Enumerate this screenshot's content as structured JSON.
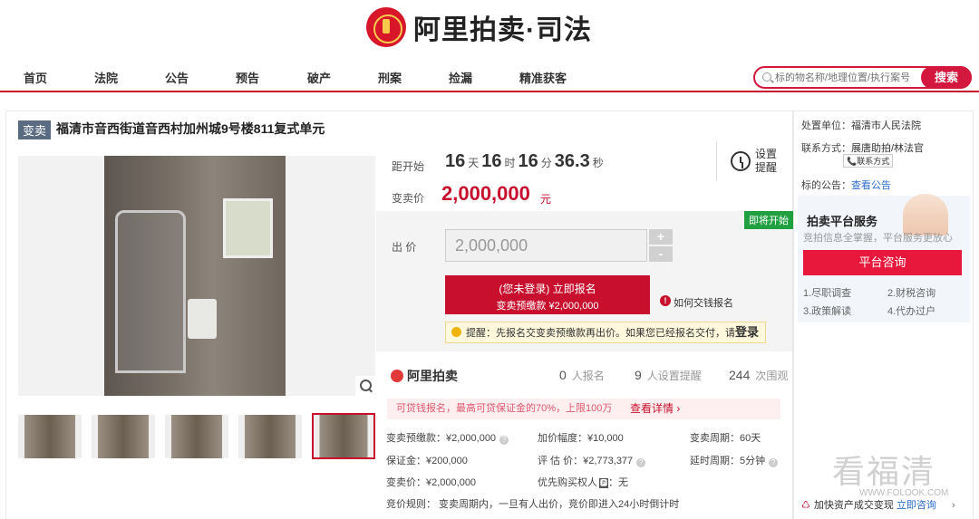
{
  "site": {
    "logo_text": "阿里拍卖·司法"
  },
  "nav": {
    "items": [
      "首页",
      "法院",
      "公告",
      "预告",
      "破产",
      "刑案",
      "捡漏",
      "精准获客"
    ]
  },
  "search": {
    "placeholder": "标的物名称/地理位置/执行案号",
    "button": "搜索"
  },
  "item": {
    "tag": "变卖",
    "title": "福清市音西街道音西村加州城9号楼811复式单元"
  },
  "countdown": {
    "label": "距开始",
    "days": "16",
    "days_unit": "天",
    "hours": "16",
    "hours_unit": "时",
    "minutes": "16",
    "minutes_unit": "分",
    "seconds": "36.3",
    "seconds_unit": "秒"
  },
  "reminder": {
    "label": "设置提醒"
  },
  "price": {
    "label": "变卖价",
    "value": "2,000,000",
    "unit": "元"
  },
  "status_badge": "即将开始",
  "bid": {
    "label": "出 价",
    "value": "2,000,000",
    "plus": "+",
    "minus": "-"
  },
  "signup": {
    "line1": "(您未登录) 立即报名",
    "line2": "变卖预缴款 ¥2,000,000"
  },
  "how_to_pay": {
    "icon": "!",
    "label": "如何交钱报名"
  },
  "tip": {
    "prefix": "提醒：先报名交变卖预缴款再出价。如果您已经报名交付，请",
    "login": "登录"
  },
  "platform": {
    "logo_text": "阿里拍卖"
  },
  "stats": {
    "signups": {
      "value": "0",
      "label": "人报名"
    },
    "reminders": {
      "value": "9",
      "label": "人设置提醒"
    },
    "views": {
      "value": "244",
      "label": "次围观"
    }
  },
  "promo": {
    "text": "可贷钱报名，最高可贷保证金的70%，上限100万",
    "link": "查看详情 ›"
  },
  "details": {
    "deposit_payment": "变卖预缴款：¥2,000,000",
    "increment": "加价幅度：¥10,000",
    "period": "变卖周期：60天",
    "margin": "保证金：¥200,000",
    "appraisal": "评 估 价：¥2,773,377",
    "extension": "延时周期：5分钟",
    "sale_price": "变卖价：¥2,000,000",
    "priority": "优先购买权人",
    "priority_badge": "🅿",
    "priority_value": "：无",
    "rules": "竞价规则：  变卖周期内，一旦有人出价，竞价即进入24小时倒计时"
  },
  "help_icon": "?",
  "side": {
    "org_label": "处置单位：",
    "org_value": "福清市人民法院",
    "contact_label": "联系方式：",
    "contact_value": "展唐助拍/林法官",
    "contact_button": "📞联系方式",
    "notice_label": "标的公告：",
    "notice_link": "查看公告",
    "service_title": "拍卖平台服务",
    "service_sub": "竞拍信息全掌握，平台服务更放心",
    "consult_button": "平台咨询",
    "services": [
      "1.尽职调查",
      "2.财税咨询",
      "3.政策解读",
      "4.代办过户"
    ],
    "bottom_text": "加快资产成交变现",
    "bottom_link": "立即咨询",
    "bottom_arrow": "›"
  },
  "watermark": {
    "text": "看福清",
    "url": "WWW.FOLOOK.COM"
  },
  "colors": {
    "brand_red": "#c8102e",
    "badge_green": "#20a040",
    "tag_slate": "#5a6b82"
  }
}
